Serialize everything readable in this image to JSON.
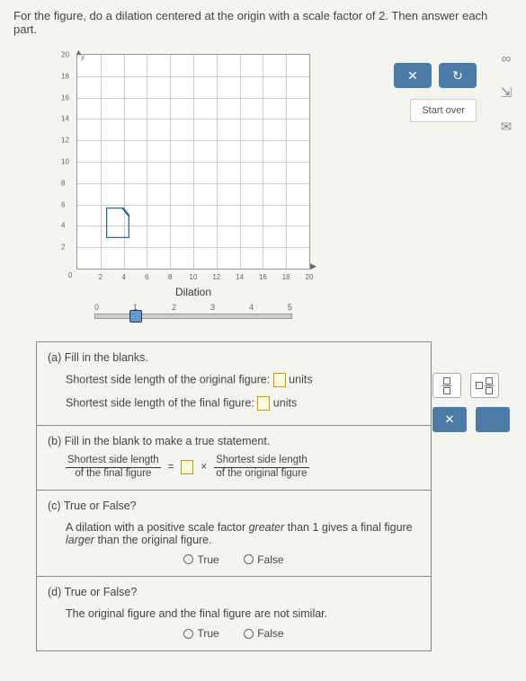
{
  "instruction": "For the figure, do a dilation centered at the origin with a scale factor of 2. Then answer each part.",
  "graph": {
    "dilation_label": "Dilation",
    "y_ticks": [
      "20",
      "18",
      "16",
      "14",
      "12",
      "10",
      "8",
      "6",
      "4",
      "2"
    ],
    "x_ticks": [
      "2",
      "4",
      "6",
      "8",
      "10",
      "12",
      "14",
      "16",
      "18",
      "20"
    ],
    "origin": "0"
  },
  "slider": {
    "ticks": [
      "0",
      "1",
      "2",
      "3",
      "4",
      "5"
    ]
  },
  "controls": {
    "close": "✕",
    "undo": "↻",
    "start_over": "Start over"
  },
  "side": {
    "infinity": "∞",
    "export": "⇲",
    "mail": "✉"
  },
  "qa": {
    "a": {
      "label": "(a)  Fill in the blanks.",
      "line1_pre": "Shortest side length of the original figure: ",
      "line1_post": " units",
      "line2_pre": "Shortest side length of the final figure: ",
      "line2_post": " units"
    },
    "b": {
      "label": "(b)  Fill in the blank to make a true statement.",
      "left_top": "Shortest side length",
      "left_bot": "of the final figure",
      "eq": "=",
      "times": "×",
      "right_top": "Shortest side length",
      "right_bot": "of the original figure"
    },
    "c": {
      "label": "(c)  True or False?",
      "text_l1": "A dilation with a positive scale factor ",
      "text_em1": "greater",
      "text_mid": " than 1 gives a final figure ",
      "text_em2": "larger",
      "text_end": " than the original figure.",
      "true": "True",
      "false": "False"
    },
    "d": {
      "label": "(d)  True or False?",
      "text": "The original figure and the final figure are not similar.",
      "true": "True",
      "false": "False"
    }
  },
  "tools": {
    "close": "✕"
  }
}
